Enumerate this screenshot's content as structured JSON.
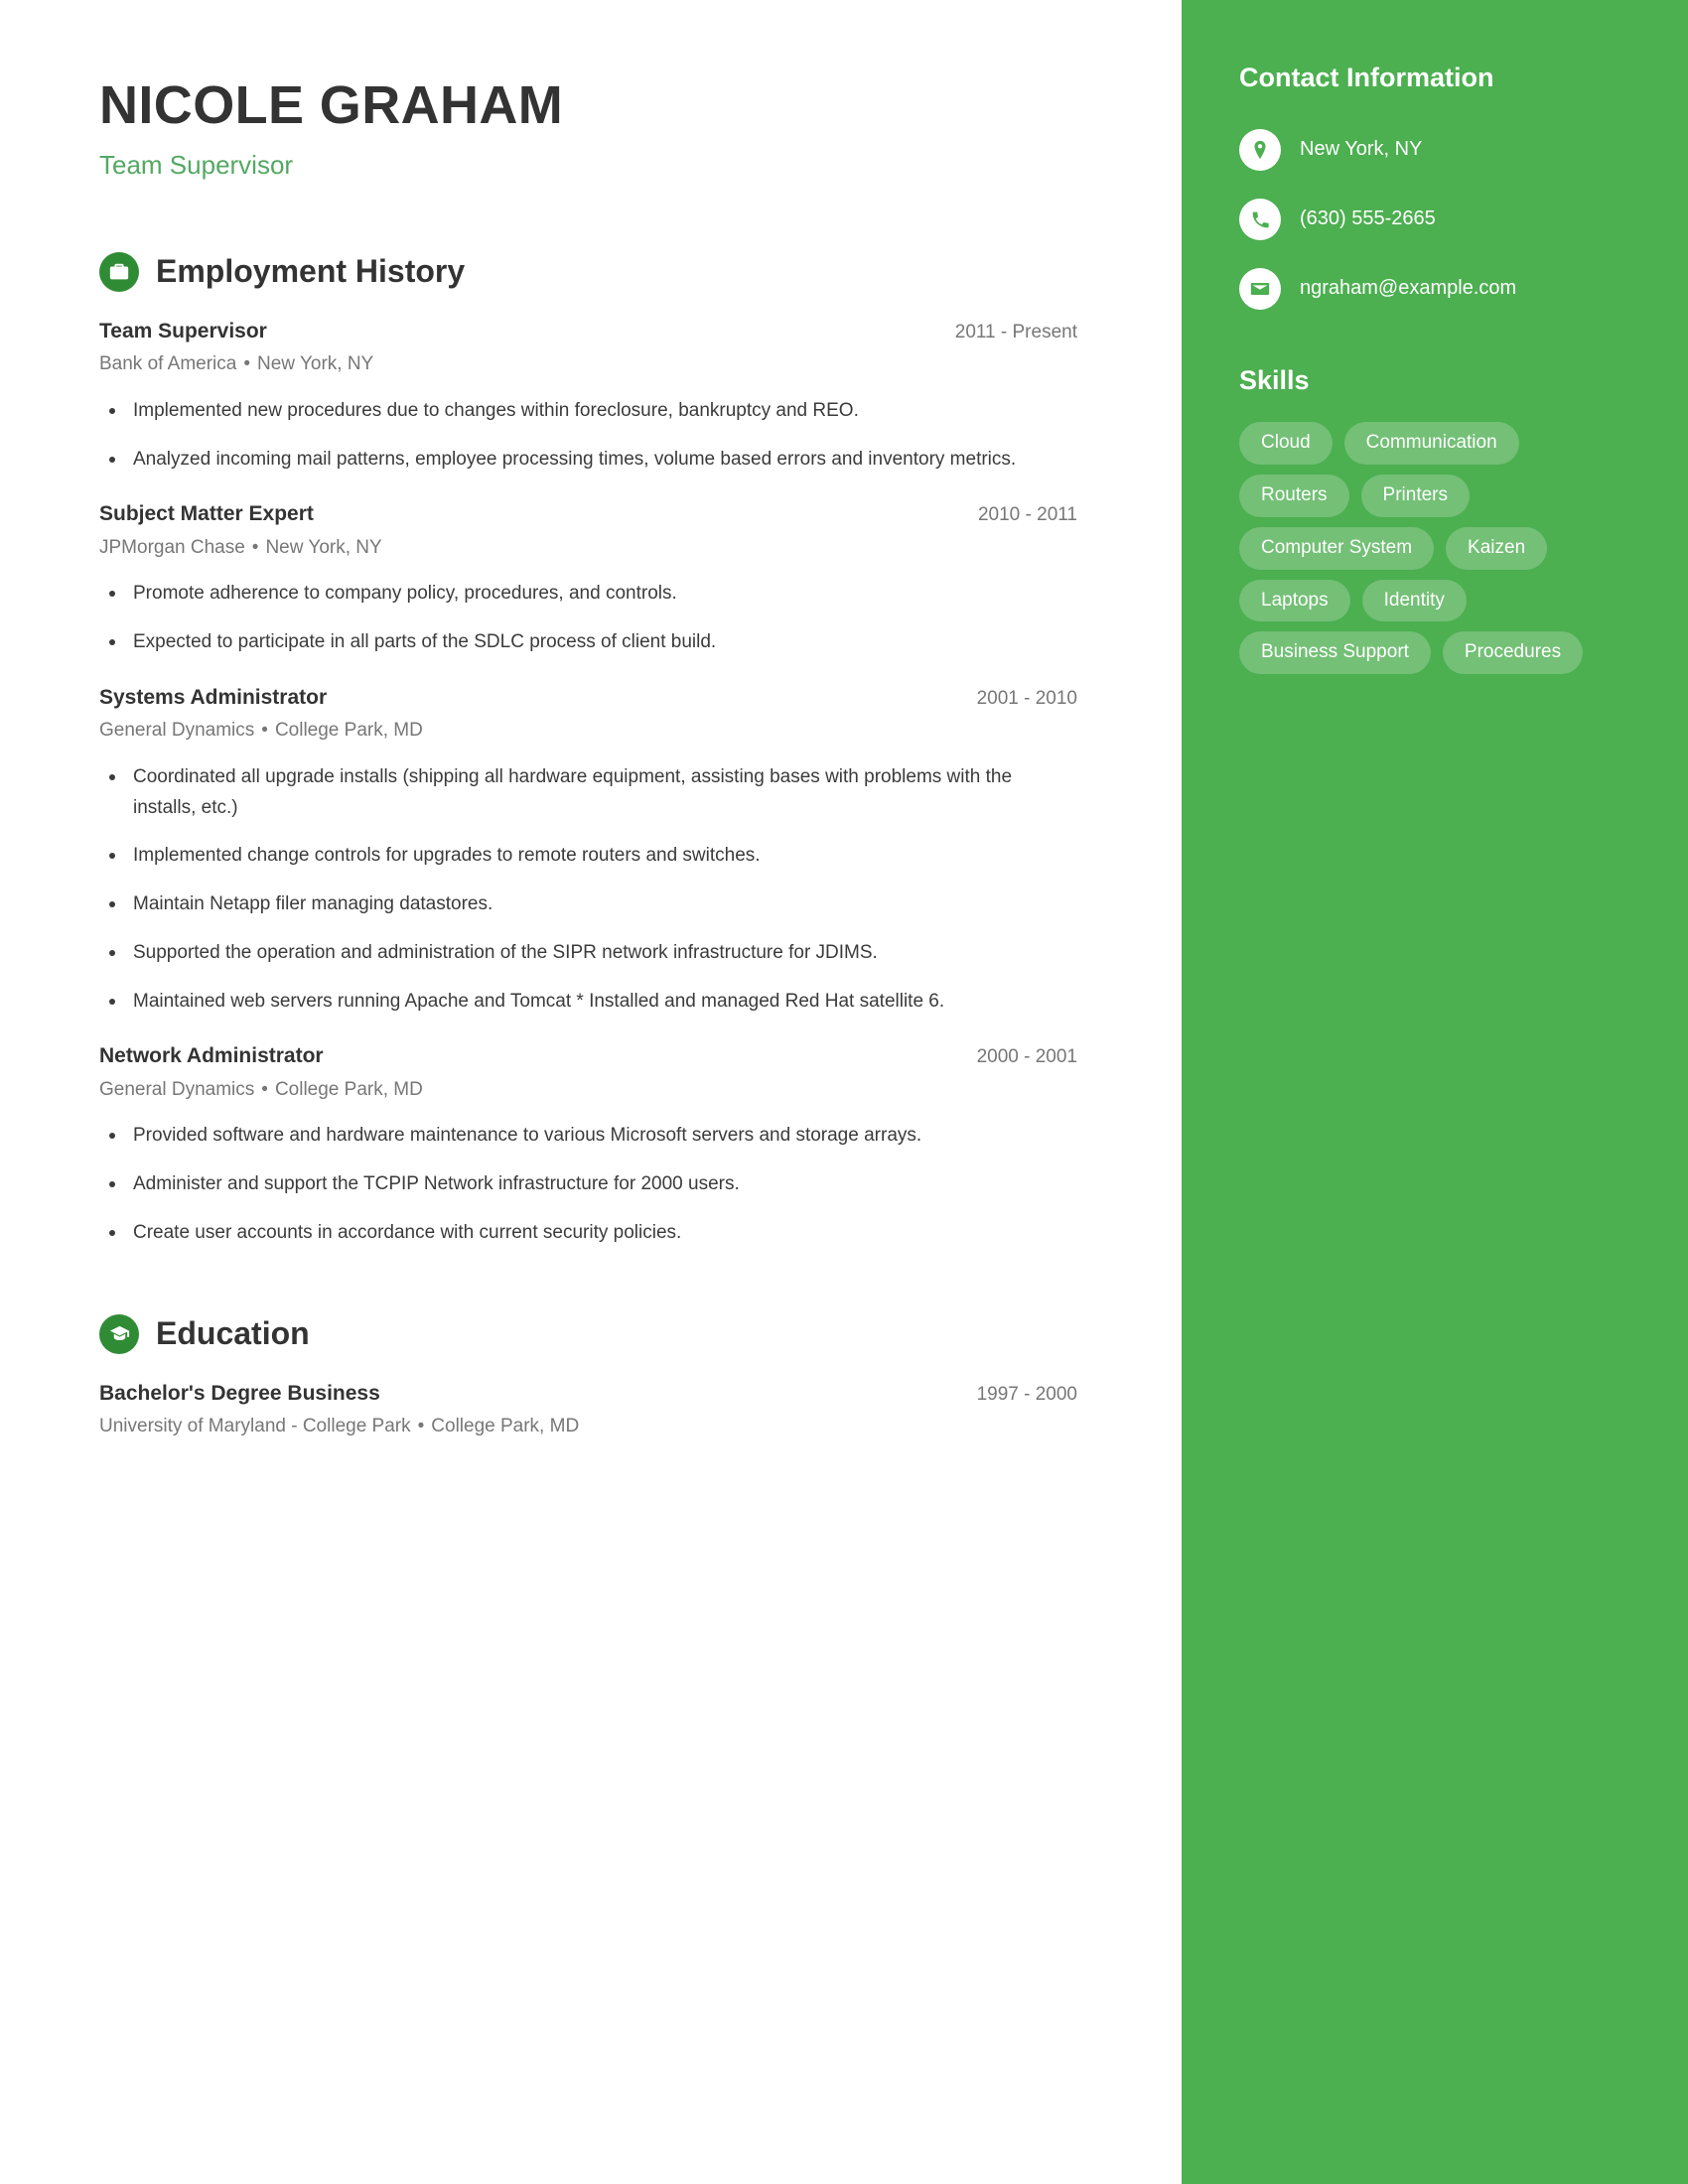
{
  "theme": {
    "sidebar_green": "#4caf50",
    "accent_green": "#54a864",
    "icon_green": "#2f8c35",
    "heading_dark": "#333333",
    "muted_gray": "#777777"
  },
  "header": {
    "name": "NICOLE GRAHAM",
    "title": "Team Supervisor"
  },
  "employment": {
    "section_title": "Employment History",
    "icon": "briefcase-icon",
    "entries": [
      {
        "role": "Team Supervisor",
        "dates": "2011 - Present",
        "company": "Bank of America",
        "separator": "•",
        "location": "New York, NY",
        "bullets": [
          "Implemented new procedures due to changes within foreclosure, bankruptcy and REO.",
          "Analyzed incoming mail patterns, employee processing times, volume based errors and inventory metrics."
        ]
      },
      {
        "role": "Subject Matter Expert",
        "dates": "2010 - 2011",
        "company": "JPMorgan Chase",
        "separator": "•",
        "location": "New York, NY",
        "bullets": [
          "Promote adherence to company policy, procedures, and controls.",
          "Expected to participate in all parts of the SDLC process of client build."
        ]
      },
      {
        "role": "Systems Administrator",
        "dates": "2001 - 2010",
        "company": "General Dynamics",
        "separator": "•",
        "location": "College Park, MD",
        "bullets": [
          "Coordinated all upgrade installs (shipping all hardware equipment, assisting bases with problems with the installs, etc.)",
          "Implemented change controls for upgrades to remote routers and switches.",
          "Maintain Netapp filer managing datastores.",
          "Supported the operation and administration of the SIPR network infrastructure for JDIMS.",
          "Maintained web servers running Apache and Tomcat * Installed and managed Red Hat satellite 6."
        ]
      },
      {
        "role": "Network Administrator",
        "dates": "2000 - 2001",
        "company": "General Dynamics",
        "separator": "•",
        "location": "College Park, MD",
        "bullets": [
          "Provided software and hardware maintenance to various Microsoft servers and storage arrays.",
          "Administer and support the TCPIP Network infrastructure for 2000 users.",
          "Create user accounts in accordance with current security policies."
        ]
      }
    ]
  },
  "education": {
    "section_title": "Education",
    "icon": "graduation-cap-icon",
    "entries": [
      {
        "degree": "Bachelor's Degree Business",
        "dates": "1997 - 2000",
        "school": "University of Maryland - College Park",
        "separator": "•",
        "location": "College Park, MD"
      }
    ]
  },
  "sidebar": {
    "contact_title": "Contact Information",
    "contacts": [
      {
        "icon": "location-pin-icon",
        "value": "New York, NY"
      },
      {
        "icon": "phone-icon",
        "value": "(630) 555-2665"
      },
      {
        "icon": "envelope-icon",
        "value": "ngraham@example.com"
      }
    ],
    "skills_title": "Skills",
    "skills": [
      "Cloud",
      "Communication",
      "Routers",
      "Printers",
      "Computer System",
      "Kaizen",
      "Laptops",
      "Identity",
      "Business Support",
      "Procedures"
    ]
  }
}
